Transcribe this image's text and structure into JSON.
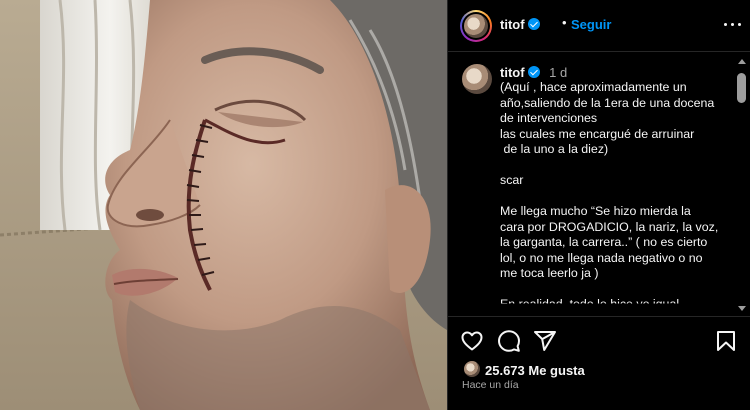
{
  "post": {
    "author": "titof",
    "follow_label": "Seguir",
    "separator": "•",
    "caption_time": "1 d",
    "caption_lines": [
      "(Aquí , hace aproximadamente un",
      "año,saliendo de la 1era de una docena",
      "de intervenciones",
      "las cuales me encargué de arruinar",
      " de la uno a la diez)",
      "",
      "scar",
      "",
      "Me llega mucho “Se hizo mierda la",
      "cara por DROGADICIO, la nariz, la voz,",
      "la garganta, la carrera..” ( no es cierto",
      "lol, o no me llega nada negativo o no",
      "me toca leerlo ja )",
      "",
      "En realidad, todo lo hice yo igual"
    ],
    "likes": "25.673",
    "likes_label": "Me gusta",
    "posted_ago": "Hace un día"
  },
  "icons": {
    "verified": "verified-badge-icon",
    "more": "more-options-icon",
    "like": "heart-icon",
    "comment": "comment-icon",
    "share": "share-icon",
    "save": "bookmark-icon"
  },
  "colors": {
    "background": "#000000",
    "link": "#0095f6",
    "text": "#f5f5f5",
    "muted": "#a8a8a8",
    "divider": "#262626"
  }
}
